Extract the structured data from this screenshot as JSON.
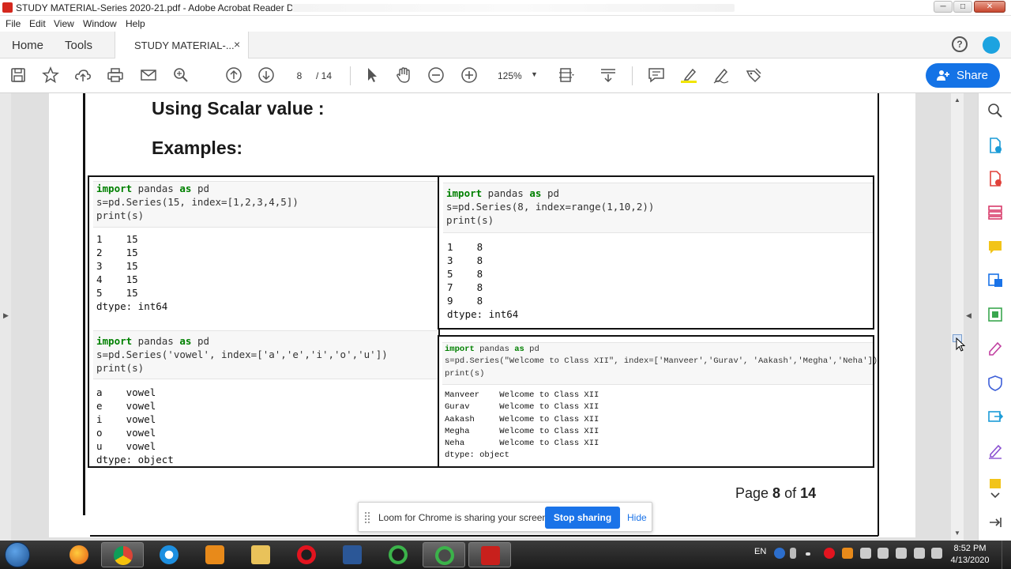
{
  "window": {
    "title": "STUDY MATERIAL-Series  2020-21.pdf - Adobe Acrobat Reader DC",
    "minimize": "─",
    "maximize": "□",
    "close": "✕"
  },
  "menu": [
    "File",
    "Edit",
    "View",
    "Window",
    "Help"
  ],
  "tabs": {
    "home": "Home",
    "tools": "Tools",
    "document": "STUDY MATERIAL-...",
    "close": "×"
  },
  "toolbar": {
    "page_current": "8",
    "page_total": "/ 14",
    "zoom": "125%",
    "zoom_dropdown": "▼",
    "share_label": "Share"
  },
  "document": {
    "heading1": "Using Scalar value :",
    "heading2": "Examples:",
    "footer_prefix": "Page ",
    "footer_page": "8",
    "footer_of": " of ",
    "footer_total": "14",
    "example1": {
      "code_line1_kw1": "import",
      "code_line1_mod": " pandas ",
      "code_line1_kw2": "as",
      "code_line1_alias": " pd",
      "code_line2": "s=pd.Series(15, index=[1,2,3,4,5])",
      "code_line3": "print(s)",
      "output": [
        "1    15",
        "2    15",
        "3    15",
        "4    15",
        "5    15",
        "dtype: int64"
      ]
    },
    "example2": {
      "code_line1_kw1": "import",
      "code_line1_mod": " pandas ",
      "code_line1_kw2": "as",
      "code_line1_alias": " pd",
      "code_line2": "s=pd.Series(8, index=range(1,10,2))",
      "code_line3": "print(s)",
      "output": [
        "1    8",
        "3    8",
        "5    8",
        "7    8",
        "9    8",
        "dtype: int64"
      ]
    },
    "example3": {
      "code_line1_kw1": "import",
      "code_line1_mod": " pandas ",
      "code_line1_kw2": "as",
      "code_line1_alias": " pd",
      "code_line2": "s=pd.Series('vowel', index=['a','e','i','o','u'])",
      "code_line3": "print(s)",
      "output": [
        "a    vowel",
        "e    vowel",
        "i    vowel",
        "o    vowel",
        "u    vowel",
        "dtype: object"
      ]
    },
    "example4": {
      "code_line1_kw1": "import",
      "code_line1_mod": " pandas ",
      "code_line1_kw2": "as",
      "code_line1_alias": " pd",
      "code_line2": "s=pd.Series(\"Welcome to Class XII\", index=['Manveer','Gurav', 'Aakash','Megha','Neha'])",
      "code_line3": "print(s)",
      "output": [
        "Manveer    Welcome to Class XII",
        "Gurav      Welcome to Class XII",
        "Aakash     Welcome to Class XII",
        "Megha      Welcome to Class XII",
        "Neha       Welcome to Class XII",
        "dtype: object"
      ]
    }
  },
  "loom": {
    "message": "Loom for Chrome is sharing your screen.",
    "stop_label": "Stop sharing",
    "hide_label": "Hide"
  },
  "taskbar": {
    "lang": "EN",
    "time": "8:52 PM",
    "date": "4/13/2020"
  },
  "colors": {
    "accent": "#1473e6",
    "loom_button": "#1a73e8",
    "acrobat_red": "#d4281e",
    "keyword_green": "#008000",
    "string_red": "#ba2121"
  }
}
